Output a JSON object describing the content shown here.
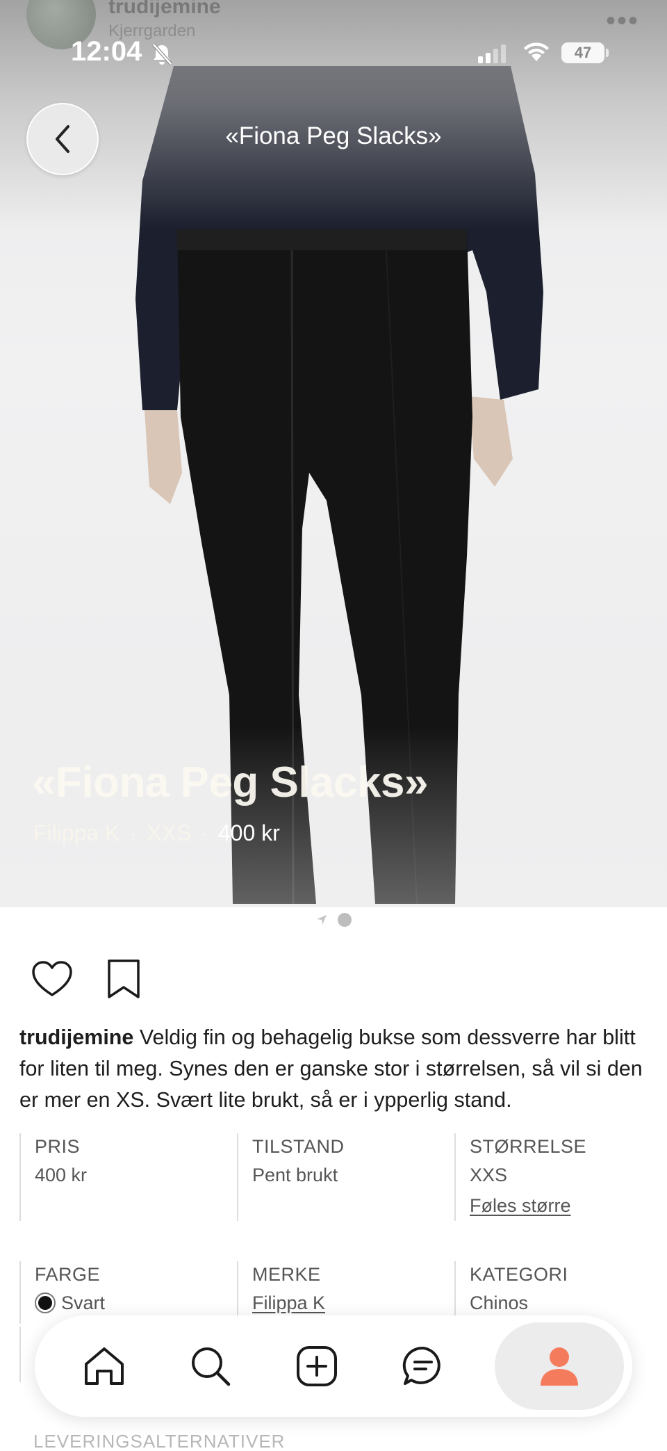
{
  "background_user": {
    "name": "trudijemine",
    "location": "Kjerrgarden"
  },
  "status_bar": {
    "time": "12:04",
    "battery": "47"
  },
  "header": {
    "title": "«Fiona Peg Slacks»"
  },
  "listing": {
    "title": "«Fiona Peg Slacks»",
    "brand": "Filippa K",
    "size": "XXS",
    "price": "400 kr",
    "separator": "·"
  },
  "post": {
    "username": "trudijemine",
    "description": "Veldig fin og behagelig bukse som dessverre har blitt for liten til meg. Synes den er ganske stor i størrelsen, så vil si den er mer en XS. Svært lite brukt, så er i ypperlig stand."
  },
  "details": {
    "price_label": "PRIS",
    "price_value": "400 kr",
    "condition_label": "TILSTAND",
    "condition_value": "Pent brukt",
    "size_label": "STØRRELSE",
    "size_value": "XXS",
    "size_note": "Føles større",
    "color_label": "FARGE",
    "color_value": "Svart",
    "brand_label": "MERKE",
    "brand_value": "Filippa K",
    "category_label": "KATEGORI",
    "category_value": "Chinos"
  },
  "delivery_heading": "LEVERINGSALTERNATIVER",
  "tabs": [
    "home-icon",
    "search-icon",
    "add-icon",
    "messages-icon",
    "profile-icon"
  ],
  "colors": {
    "accent": "#f47c5c",
    "garment": "#141414",
    "swatch": "#111111"
  }
}
